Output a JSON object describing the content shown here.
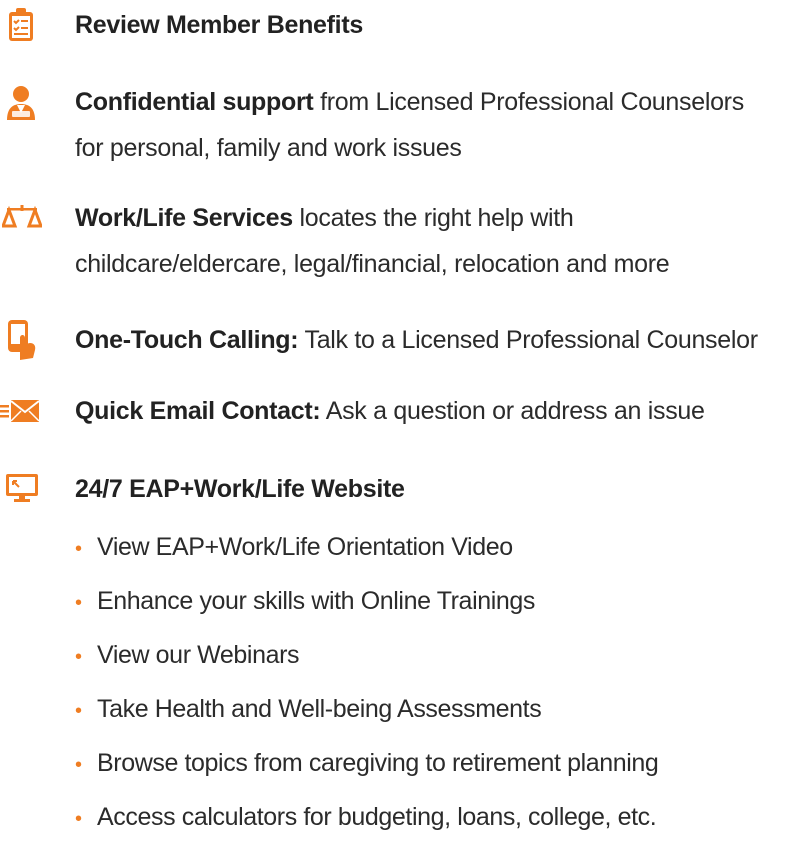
{
  "benefits": {
    "review": {
      "label": "Review Member Benefits"
    },
    "confidential": {
      "bold": "Confidential support",
      "rest_line1": " from Licensed Professional Counselors",
      "line2": "for personal, family and work issues"
    },
    "worklife": {
      "bold": "Work/Life Services",
      "rest_line1": " locates the right help with",
      "line2": "childcare/eldercare, legal/financial, relocation and more"
    },
    "calling": {
      "bold": "One-Touch Calling:",
      "rest": " Talk to a Licensed Professional Counselor"
    },
    "email": {
      "bold": "Quick Email Contact:",
      "rest": " Ask a question or address an issue"
    },
    "website": {
      "label": "24/7 EAP+Work/Life Website",
      "items": [
        "View EAP+Work/Life Orientation Video",
        "Enhance your skills with Online Trainings",
        "View our Webinars",
        "Take Health and Well-being Assessments",
        "Browse topics from caregiving to retirement planning",
        "Access calculators for budgeting, loans, college, etc."
      ]
    },
    "bullet_glyph": "•"
  },
  "colors": {
    "accent": "#ef7d22",
    "text": "#2b2b2b"
  },
  "icons": {
    "review": "clipboard-checklist-icon",
    "confidential": "counselor-person-icon",
    "worklife": "balance-scale-icon",
    "calling": "phone-touch-icon",
    "email": "email-envelope-icon",
    "website": "monitor-icon"
  }
}
